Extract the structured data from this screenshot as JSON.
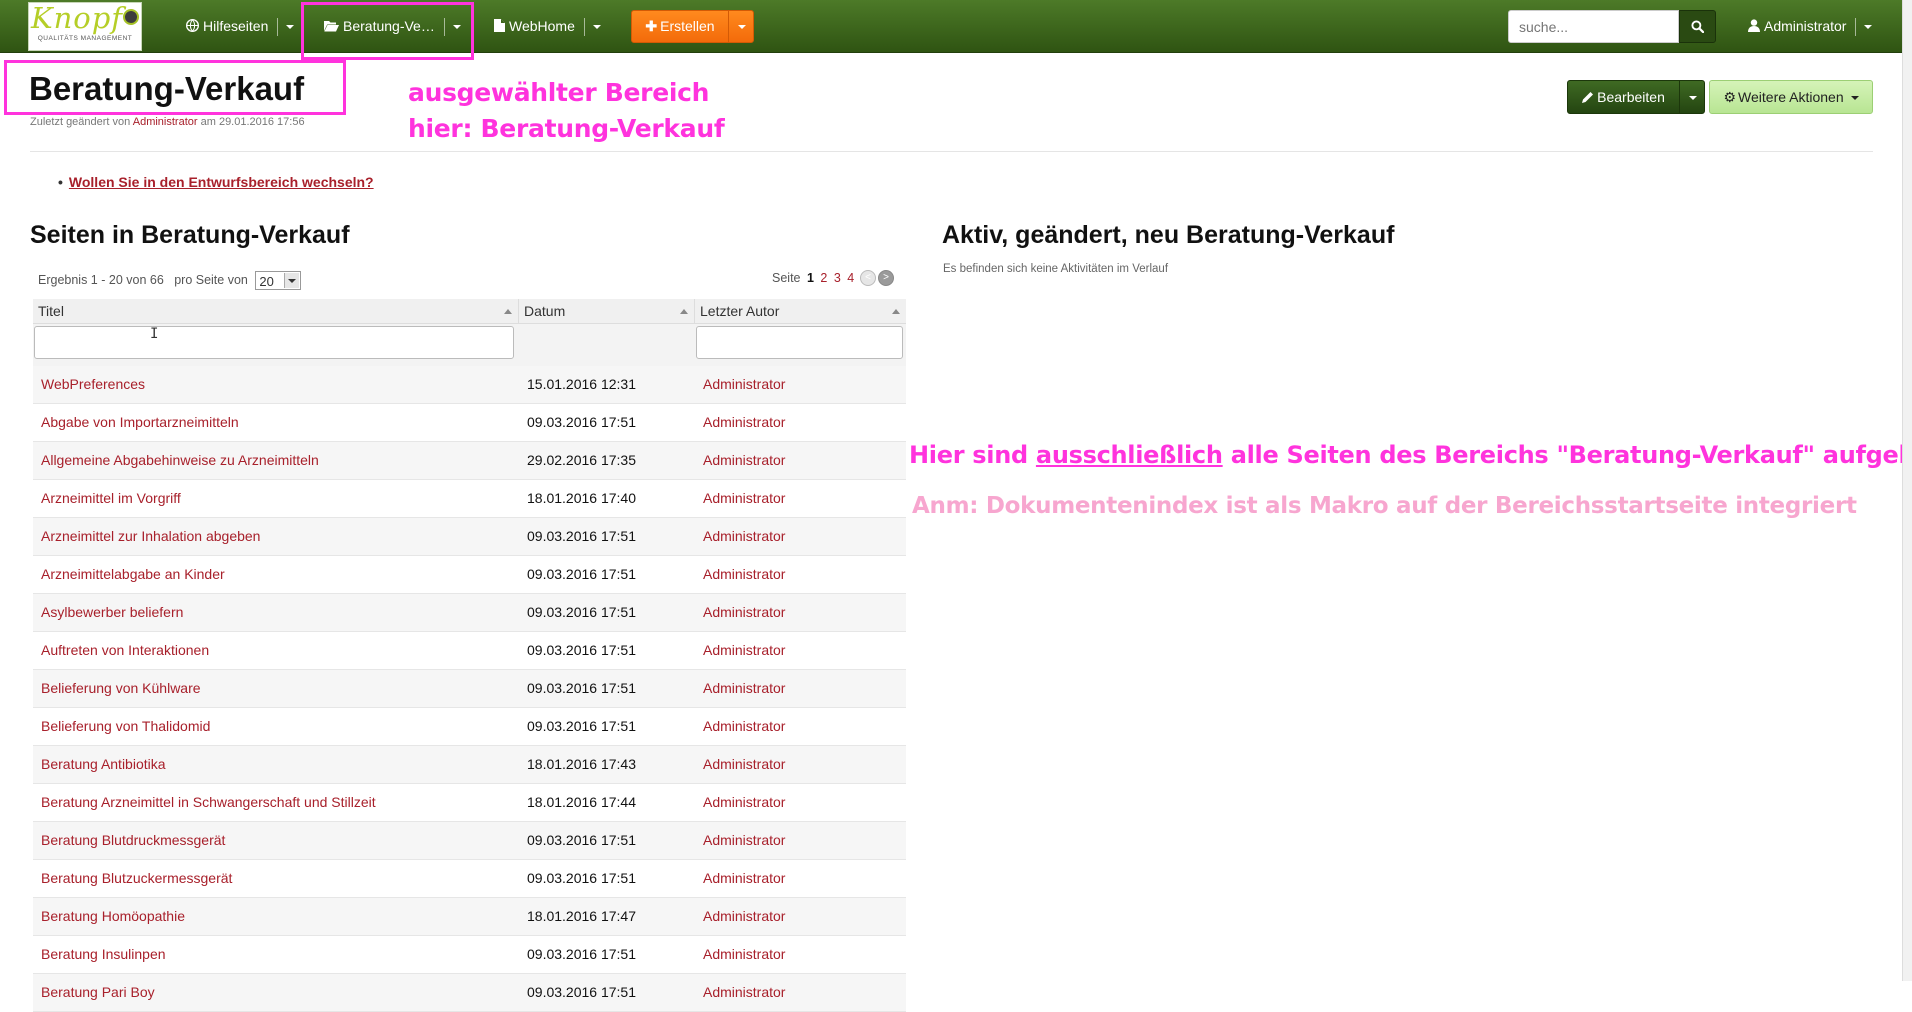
{
  "navbar": {
    "logo_word": "Knopf",
    "logo_sub": "QUALITÄTS MANAGEMENT",
    "items": [
      {
        "label": "Hilfeseiten",
        "icon": "globe-icon"
      },
      {
        "label": "Beratung-Ve…",
        "icon": "folder-open-icon"
      },
      {
        "label": "WebHome",
        "icon": "file-icon"
      }
    ],
    "create_label": "Erstellen",
    "search_placeholder": "suche...",
    "user_label": "Administrator"
  },
  "page": {
    "title": "Beratung-Verkauf",
    "meta_prefix": "Zuletzt geändert von",
    "meta_author": "Administrator",
    "meta_suffix": "am 29.01.2016 17:56",
    "edit_label": "Bearbeiten",
    "more_actions_label": "Weitere Aktionen",
    "draft_link": "Wollen Sie in den Entwurfsbereich wechseln?"
  },
  "annotations": {
    "selected_line1": "ausgewählter Bereich",
    "selected_line2": "hier: Beratung-Verkauf",
    "exclusive_pre": "Hier sind",
    "exclusive_word": "ausschließlich",
    "exclusive_post": "alle Seiten des Bereichs \"Beratung-Verkauf\" aufgelistet",
    "note": "Anm: Dokumentenindex ist als Makro auf der Bereichsstartseite integriert"
  },
  "pages_panel": {
    "title": "Seiten in Beratung-Verkauf",
    "result_text": "Ergebnis 1 - 20 von 66",
    "per_page_text": "pro Seite von",
    "per_page_value": "20",
    "pager_label": "Seite",
    "pages": [
      "1",
      "2",
      "3",
      "4"
    ],
    "columns": [
      "Titel",
      "Datum",
      "Letzter Autor"
    ],
    "rows": [
      {
        "title": "WebPreferences",
        "date": "15.01.2016 12:31",
        "author": "Administrator"
      },
      {
        "title": "Abgabe von Importarzneimitteln",
        "date": "09.03.2016 17:51",
        "author": "Administrator"
      },
      {
        "title": "Allgemeine Abgabehinweise zu Arzneimitteln",
        "date": "29.02.2016 17:35",
        "author": "Administrator"
      },
      {
        "title": "Arzneimittel im Vorgriff",
        "date": "18.01.2016 17:40",
        "author": "Administrator"
      },
      {
        "title": "Arzneimittel zur Inhalation abgeben",
        "date": "09.03.2016 17:51",
        "author": "Administrator"
      },
      {
        "title": "Arzneimittelabgabe an Kinder",
        "date": "09.03.2016 17:51",
        "author": "Administrator"
      },
      {
        "title": "Asylbewerber beliefern",
        "date": "09.03.2016 17:51",
        "author": "Administrator"
      },
      {
        "title": "Auftreten von Interaktionen",
        "date": "09.03.2016 17:51",
        "author": "Administrator"
      },
      {
        "title": "Belieferung von Kühlware",
        "date": "09.03.2016 17:51",
        "author": "Administrator"
      },
      {
        "title": "Belieferung von Thalidomid",
        "date": "09.03.2016 17:51",
        "author": "Administrator"
      },
      {
        "title": "Beratung Antibiotika",
        "date": "18.01.2016 17:43",
        "author": "Administrator"
      },
      {
        "title": "Beratung Arzneimittel in Schwangerschaft und Stillzeit",
        "date": "18.01.2016 17:44",
        "author": "Administrator"
      },
      {
        "title": "Beratung Blutdruckmessgerät",
        "date": "09.03.2016 17:51",
        "author": "Administrator"
      },
      {
        "title": "Beratung Blutzuckermessgerät",
        "date": "09.03.2016 17:51",
        "author": "Administrator"
      },
      {
        "title": "Beratung Homöopathie",
        "date": "18.01.2016 17:47",
        "author": "Administrator"
      },
      {
        "title": "Beratung Insulinpen",
        "date": "09.03.2016 17:51",
        "author": "Administrator"
      },
      {
        "title": "Beratung Pari Boy",
        "date": "09.03.2016 17:51",
        "author": "Administrator"
      }
    ]
  },
  "activity_panel": {
    "title": "Aktiv, geändert, neu Beratung-Verkauf",
    "empty_text": "Es befinden sich keine Aktivitäten im Verlauf"
  },
  "colors": {
    "navbar_green": "#3c6519",
    "create_orange": "#f57a12",
    "link_red": "#a8202b",
    "annotation_magenta": "#ff33dd",
    "annotation_pink": "#f7a6cf"
  }
}
